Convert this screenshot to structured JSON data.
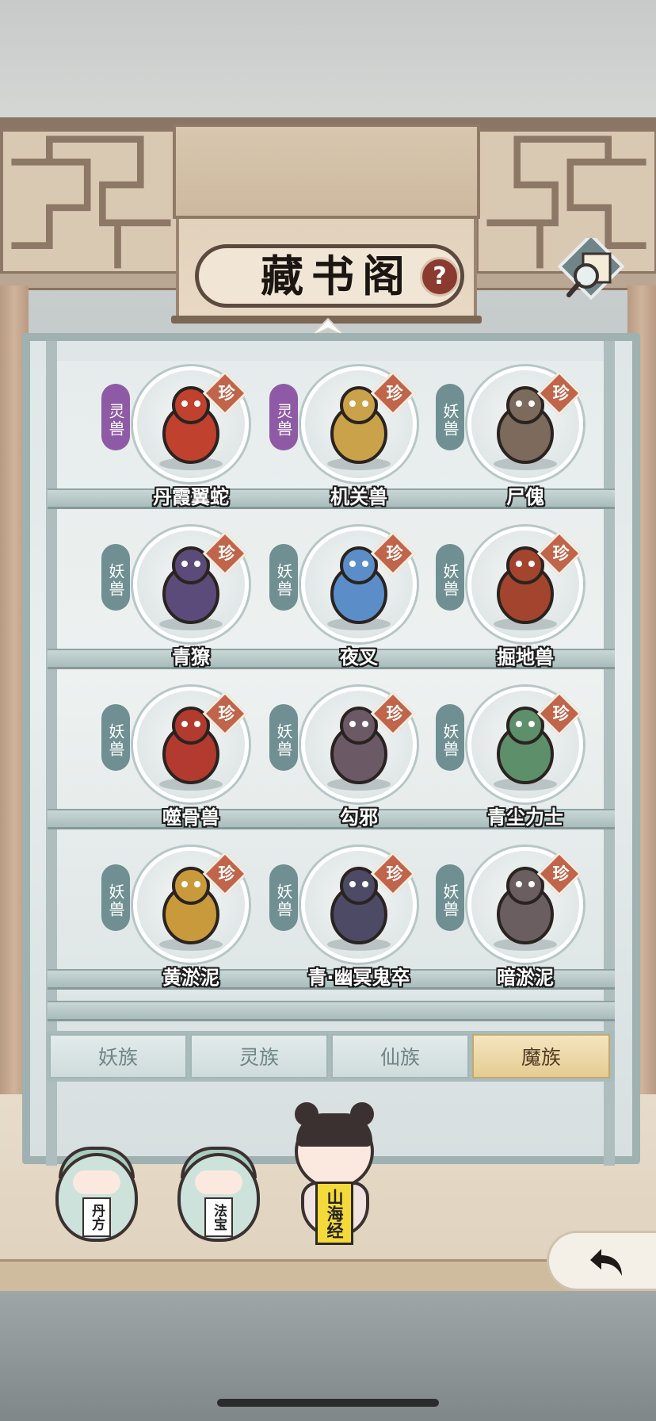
{
  "header": {
    "title": "藏书阁",
    "help_label": "?",
    "map_icon": "map-magnifier-icon"
  },
  "rarity_label": "珍",
  "creatures": [
    {
      "name": "丹霞翼蛇",
      "category": "灵兽",
      "type": "spirit",
      "color": "#c0412e"
    },
    {
      "name": "机关兽",
      "category": "灵兽",
      "type": "spirit",
      "color": "#c9a24a"
    },
    {
      "name": "尸傀",
      "category": "妖兽",
      "type": "demon",
      "color": "#7c6a5c"
    },
    {
      "name": "青獠",
      "category": "妖兽",
      "type": "demon",
      "color": "#5a4b7a"
    },
    {
      "name": "夜叉",
      "category": "妖兽",
      "type": "demon",
      "color": "#5b8ec9"
    },
    {
      "name": "掘地兽",
      "category": "妖兽",
      "type": "demon",
      "color": "#a3452e"
    },
    {
      "name": "噬骨兽",
      "category": "妖兽",
      "type": "demon",
      "color": "#b33a2f"
    },
    {
      "name": "勾邪",
      "category": "妖兽",
      "type": "demon",
      "color": "#6b5a66"
    },
    {
      "name": "青尘力士",
      "category": "妖兽",
      "type": "demon",
      "color": "#5d8f6a"
    },
    {
      "name": "黄淤泥",
      "category": "妖兽",
      "type": "demon",
      "color": "#c99a3b"
    },
    {
      "name": "青·幽冥鬼卒",
      "category": "妖兽",
      "type": "demon",
      "color": "#4d4a66"
    },
    {
      "name": "暗淤泥",
      "category": "妖兽",
      "type": "demon",
      "color": "#6a5e60"
    }
  ],
  "tabs": [
    {
      "label": "妖族",
      "active": false
    },
    {
      "label": "灵族",
      "active": false
    },
    {
      "label": "仙族",
      "active": false
    },
    {
      "label": "魔族",
      "active": true
    }
  ],
  "characters": [
    {
      "label": "丹方"
    },
    {
      "label": "法宝"
    },
    {
      "label": "山海经"
    }
  ],
  "back_icon": "back-arrow-icon"
}
